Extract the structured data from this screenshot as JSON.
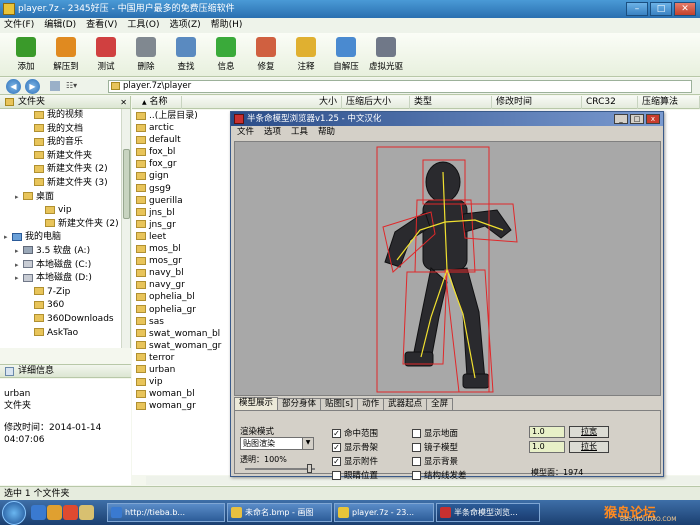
{
  "window": {
    "title": "player.7z - 2345好压 - 中国用户最多的免费压缩软件"
  },
  "menu": [
    "文件(F)",
    "编辑(D)",
    "查看(V)",
    "工具(O)",
    "选项(Z)",
    "帮助(H)"
  ],
  "toolbar": [
    {
      "label": "添加",
      "icon": "add-icon",
      "color": "#3a9a2a"
    },
    {
      "label": "解压到",
      "icon": "extract-icon",
      "color": "#e08a20"
    },
    {
      "label": "测试",
      "icon": "test-icon",
      "color": "#d04040"
    },
    {
      "label": "删除",
      "icon": "delete-icon",
      "color": "#808890"
    },
    {
      "label": "查找",
      "icon": "find-icon",
      "color": "#5a8ac0"
    },
    {
      "label": "信息",
      "icon": "info-icon",
      "color": "#3aaa3a"
    },
    {
      "label": "修复",
      "icon": "repair-icon",
      "color": "#d06040"
    },
    {
      "label": "注释",
      "icon": "comment-icon",
      "color": "#e0b030"
    },
    {
      "label": "自解压",
      "icon": "sfx-icon",
      "color": "#4a8ad0"
    },
    {
      "label": "虚拟光驱",
      "icon": "virtual-drive-icon",
      "color": "#707888"
    }
  ],
  "address": {
    "path": "player.7z\\player"
  },
  "folder_pane": {
    "title": "文件夹"
  },
  "tree": [
    {
      "label": "我的视频",
      "indent": 2
    },
    {
      "label": "我的文档",
      "indent": 2
    },
    {
      "label": "我的音乐",
      "indent": 2
    },
    {
      "label": "新建文件夹",
      "indent": 2
    },
    {
      "label": "新建文件夹 (2)",
      "indent": 2
    },
    {
      "label": "新建文件夹 (3)",
      "indent": 2
    },
    {
      "label": "桌面",
      "indent": 1
    },
    {
      "label": "vip",
      "indent": 3
    },
    {
      "label": "新建文件夹 (2)",
      "indent": 3
    },
    {
      "label": "我的电脑",
      "indent": 0
    },
    {
      "label": "3.5 软盘 (A:)",
      "indent": 1
    },
    {
      "label": "本地磁盘 (C:)",
      "indent": 1
    },
    {
      "label": "本地磁盘 (D:)",
      "indent": 1
    },
    {
      "label": "7-Zip",
      "indent": 2
    },
    {
      "label": "360",
      "indent": 2
    },
    {
      "label": "360Downloads",
      "indent": 2
    },
    {
      "label": "AskTao",
      "indent": 2
    }
  ],
  "details": {
    "title": "详细信息",
    "name": "urban",
    "type": "文件夹",
    "modified": "修改时间：2014-01-14 04:07:06"
  },
  "columns": [
    "名称",
    "大小",
    "压缩后大小",
    "类型",
    "修改时间",
    "CRC32",
    "压缩算法"
  ],
  "files": [
    "..(上层目录)",
    "arctic",
    "default",
    "fox_bl",
    "fox_gr",
    "gign",
    "gsg9",
    "guerilla",
    "jns_bl",
    "jns_gr",
    "leet",
    "mos_bl",
    "mos_gr",
    "navy_bl",
    "navy_gr",
    "ophelia_bl",
    "ophelia_gr",
    "sas",
    "swat_woman_bl",
    "swat_woman_gr",
    "terror",
    "urban",
    "vip",
    "woman_bl",
    "woman_gr"
  ],
  "status": "选中 1 个文件夹",
  "viewer": {
    "title": "半条命模型浏览器v1.25 - 中文汉化",
    "menu": [
      "文件",
      "选项",
      "工具",
      "帮助"
    ],
    "tabs": [
      "模型展示",
      "部分身体",
      "贴图[s]",
      "动作",
      "武器起点",
      "全屏"
    ],
    "render_mode_label": "渲染模式",
    "render_mode_value": "贴图渲染",
    "transparency": "透明：100%",
    "checkboxes": [
      {
        "label": "命中范围",
        "checked": true
      },
      {
        "label": "显示骨架",
        "checked": true
      },
      {
        "label": "显示附件",
        "checked": true
      },
      {
        "label": "眼睛位置",
        "checked": false
      },
      {
        "label": "显示地面",
        "checked": false
      },
      {
        "label": "镜子模型",
        "checked": false
      },
      {
        "label": "显示背景",
        "checked": false
      },
      {
        "label": "结构线发差",
        "checked": false
      }
    ],
    "scale_x": "1.0",
    "scale_y": "1.0",
    "btn_widen": "拉宽",
    "btn_lengthen": "拉长",
    "model_faces": "模型面：1974"
  },
  "taskbar": [
    {
      "label": "http://tieba.b..."
    },
    {
      "label": "未命名.bmp - 画图"
    },
    {
      "label": "player.7z - 23..."
    },
    {
      "label": "半条命模型浏览..."
    }
  ],
  "watermark": {
    "text": "猴岛论坛",
    "sub": "BBS.HOUDAO.COM"
  }
}
